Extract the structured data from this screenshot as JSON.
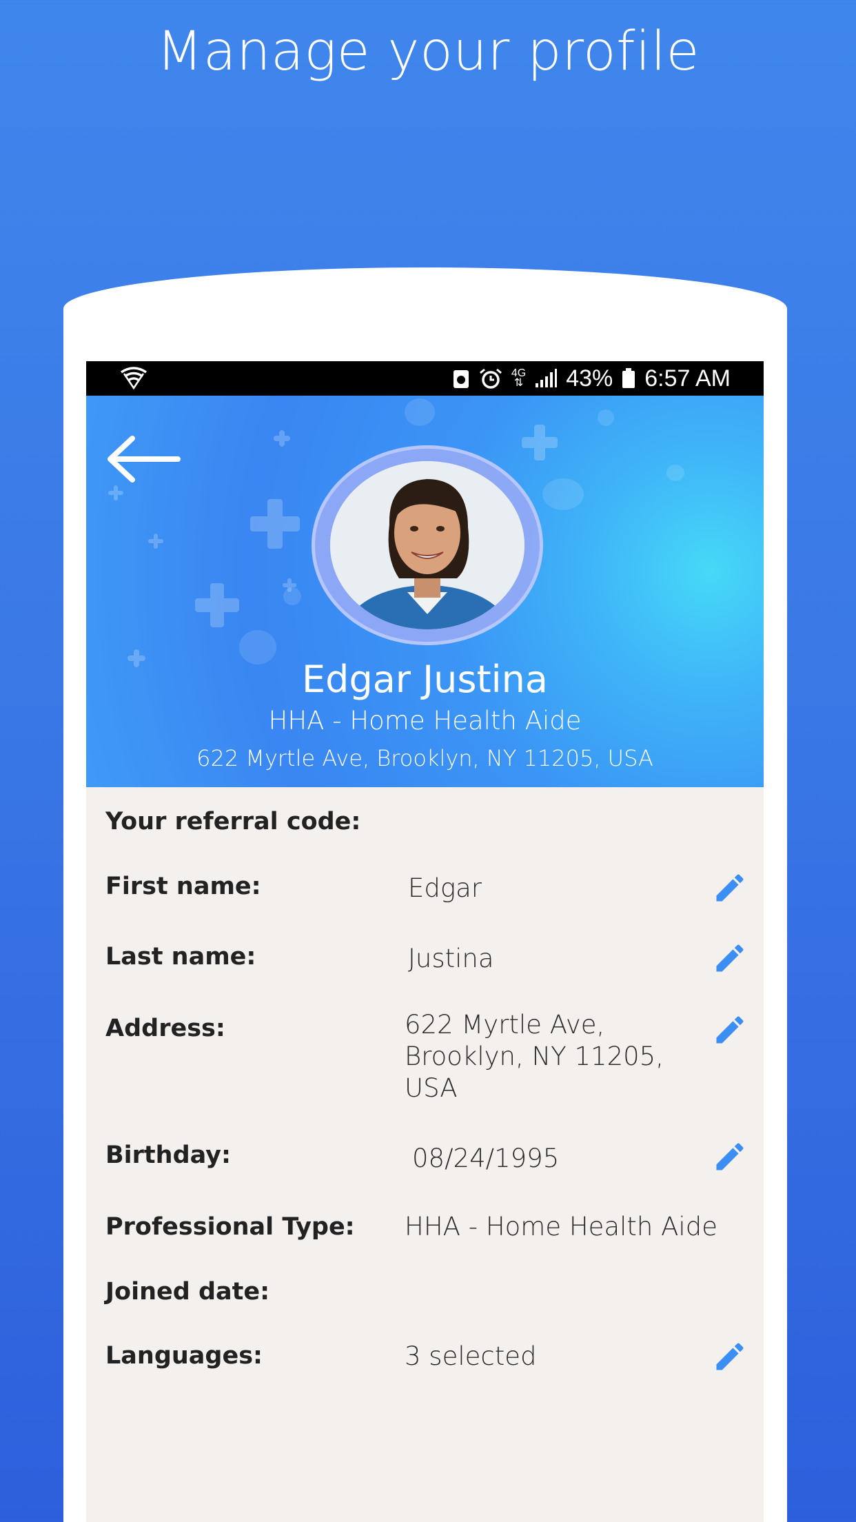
{
  "promo": {
    "title": "Manage your profile"
  },
  "status_bar": {
    "battery": "43%",
    "time": "6:57 AM",
    "network": "4G"
  },
  "profile": {
    "name": "Edgar Justina",
    "type": "HHA - Home Health Aide",
    "address": "622 Myrtle Ave, Brooklyn, NY 11205, USA"
  },
  "fields": {
    "referral": {
      "label": "Your referral code:",
      "value": ""
    },
    "first_name": {
      "label": "First name:",
      "value": "Edgar"
    },
    "last_name": {
      "label": "Last name:",
      "value": "Justina"
    },
    "address": {
      "label": "Address:",
      "value_lines": [
        "622 Myrtle Ave,",
        "Brooklyn, NY 11205,",
        "USA"
      ]
    },
    "birthday": {
      "label": "Birthday:",
      "value": "08/24/1995"
    },
    "professional_type": {
      "label": "Professional Type:",
      "value": "HHA - Home Health Aide"
    },
    "joined_date": {
      "label": "Joined date:",
      "value": ""
    },
    "languages": {
      "label": "Languages:",
      "value": "3 selected"
    }
  },
  "colors": {
    "accent": "#3b8ef3",
    "background": "#3a78e6",
    "details_bg": "#f3f0ed"
  },
  "icons": [
    "wifi-shield-icon",
    "battery-saver-icon",
    "alarm-icon",
    "signal-icon",
    "battery-icon",
    "back-arrow-icon",
    "pencil-edit-icon"
  ]
}
